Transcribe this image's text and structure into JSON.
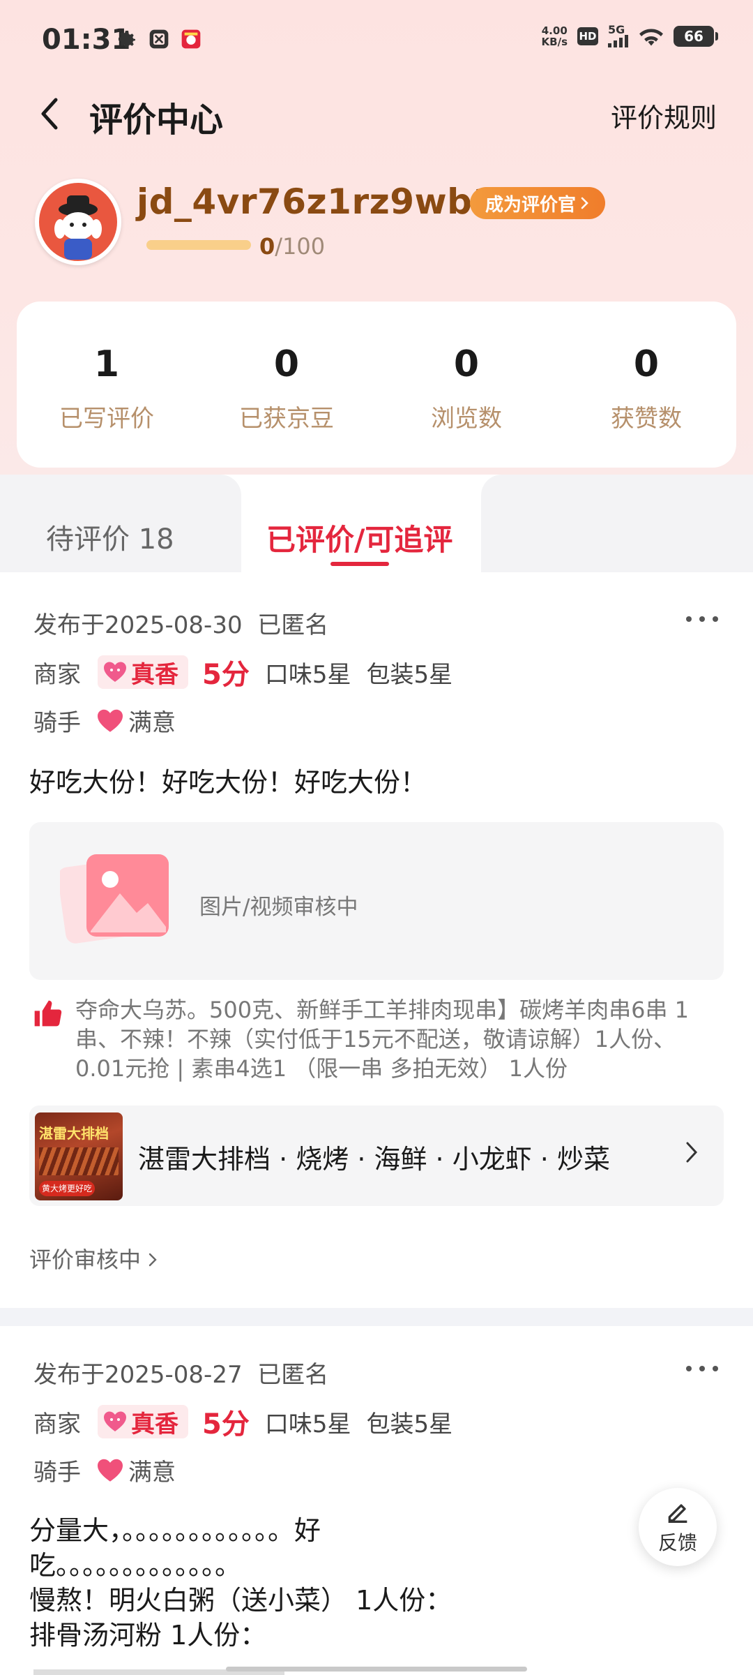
{
  "status_bar": {
    "time": "01:31",
    "net_speed_value": "4.00",
    "net_speed_unit": "KB/s",
    "hd_label": "HD",
    "network": "5G",
    "battery": "66",
    "icons": [
      "gear-icon",
      "app-icon",
      "jd-app-icon",
      "wifi-icon",
      "signal-icon"
    ]
  },
  "header": {
    "title": "评价中心",
    "rules_label": "评价规则"
  },
  "profile": {
    "username": "jd_4vr76z1rz9wb18",
    "become_reviewer_label": "成为评价官",
    "progress_current": "0",
    "progress_total": "/100",
    "progress_fraction": 0
  },
  "stats": [
    {
      "value": "1",
      "label": "已写评价"
    },
    {
      "value": "0",
      "label": "已获京豆"
    },
    {
      "value": "0",
      "label": "浏览数"
    },
    {
      "value": "0",
      "label": "获赞数"
    }
  ],
  "tabs": [
    {
      "label": "待评价 18",
      "active": false
    },
    {
      "label": "已评价/可追评",
      "active": true
    }
  ],
  "reviews": [
    {
      "date": "发布于2025-08-30",
      "anonymous": "已匿名",
      "merchant_label": "商家",
      "merchant_tag": "真香",
      "score": "5分",
      "taste": "口味5星",
      "packaging": "包装5星",
      "rider_label": "骑手",
      "rider_rating": "满意",
      "content": "好吃大份！好吃大份！好吃大份！",
      "media_status": "图片/视频审核中",
      "item_desc": "夺命大乌苏。500克、新鲜手工羊排肉现串】碳烤羊肉串6串 1串、不辣！不辣（实付低于15元不配送，敬请谅解）1人份、0.01元抢 | 素串4选1 （限一串 多拍无效） 1人份",
      "shop_name": "湛雷大排档 · 烧烤 · 海鲜 · 小龙虾 · 炒菜",
      "shop_img_title": "湛雷大排档",
      "shop_img_badge": "黄大烤更好吃",
      "audit_status": "评价审核中"
    },
    {
      "date": "发布于2025-08-27",
      "anonymous": "已匿名",
      "merchant_label": "商家",
      "merchant_tag": "真香",
      "score": "5分",
      "taste": "口味5星",
      "packaging": "包装5星",
      "rider_label": "骑手",
      "rider_rating": "满意",
      "content_lines": [
        "分量大，。。。。。。。。。。。。好",
        "吃。。。。。。。。。。。。。",
        "慢熬！明火白粥（送小菜） 1人份：",
        "排骨汤河粉 1人份："
      ]
    }
  ],
  "feedback_label": "反馈",
  "colors": {
    "accent": "#e4263d",
    "brand_brown": "#8a4a12",
    "gold_label": "#b6906b",
    "hero_bg": "#fde3e1"
  }
}
